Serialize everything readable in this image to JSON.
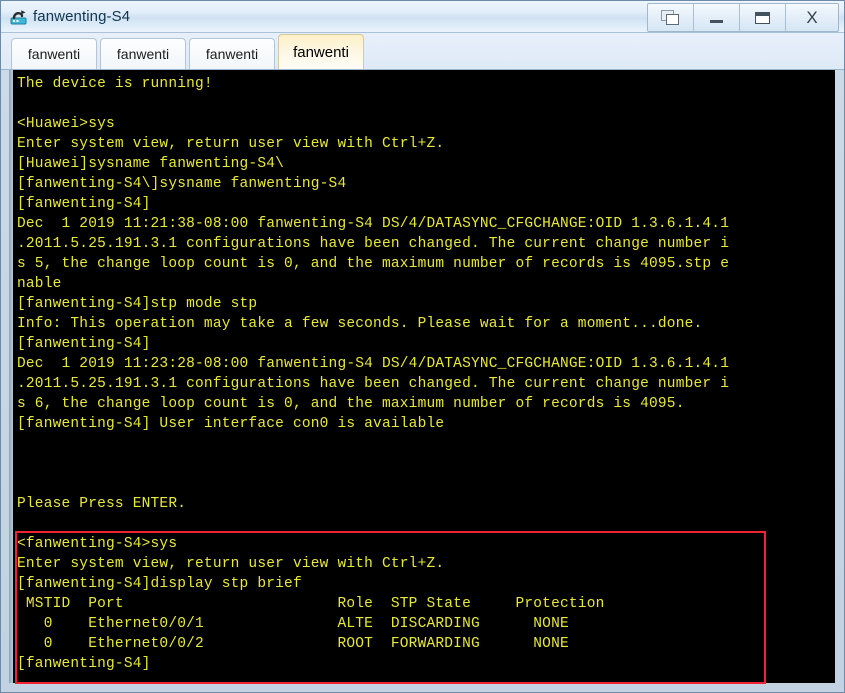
{
  "window": {
    "title": "fanwenting-S4",
    "icon": "router-device-icon",
    "controls": [
      {
        "name": "restore-windows-button",
        "icon": "cascade-windows-icon",
        "label": ""
      },
      {
        "name": "minimize-button",
        "icon": "minimize-icon",
        "label": ""
      },
      {
        "name": "maximize-button",
        "icon": "maximize-icon",
        "label": ""
      },
      {
        "name": "close-button",
        "icon": "close-icon",
        "label": "X"
      }
    ]
  },
  "tabs": [
    {
      "label": "fanwenti",
      "active": false
    },
    {
      "label": "fanwenti",
      "active": false
    },
    {
      "label": "fanwenti",
      "active": false
    },
    {
      "label": "fanwenti",
      "active": true
    }
  ],
  "terminal": {
    "foreground_color": "#e8e83a",
    "background_color": "#000000",
    "lines": [
      "The device is running!",
      "",
      "<Huawei>sys",
      "Enter system view, return user view with Ctrl+Z.",
      "[Huawei]sysname fanwenting-S4\\",
      "[fanwenting-S4\\]sysname fanwenting-S4",
      "[fanwenting-S4]",
      "Dec  1 2019 11:21:38-08:00 fanwenting-S4 DS/4/DATASYNC_CFGCHANGE:OID 1.3.6.1.4.1",
      ".2011.5.25.191.3.1 configurations have been changed. The current change number i",
      "s 5, the change loop count is 0, and the maximum number of records is 4095.stp e",
      "nable",
      "[fanwenting-S4]stp mode stp",
      "Info: This operation may take a few seconds. Please wait for a moment...done.",
      "[fanwenting-S4]",
      "Dec  1 2019 11:23:28-08:00 fanwenting-S4 DS/4/DATASYNC_CFGCHANGE:OID 1.3.6.1.4.1",
      ".2011.5.25.191.3.1 configurations have been changed. The current change number i",
      "s 6, the change loop count is 0, and the maximum number of records is 4095.",
      "[fanwenting-S4] User interface con0 is available",
      "",
      "",
      "",
      "Please Press ENTER.",
      "",
      "<fanwenting-S4>sys",
      "Enter system view, return user view with Ctrl+Z.",
      "[fanwenting-S4]display stp brief",
      " MSTID  Port                        Role  STP State     Protection",
      "   0    Ethernet0/0/1               ALTE  DISCARDING      NONE",
      "   0    Ethernet0/0/2               ROOT  FORWARDING      NONE",
      "[fanwenting-S4]"
    ]
  },
  "stp_brief": {
    "command": "display stp brief",
    "columns": [
      "MSTID",
      "Port",
      "Role",
      "STP State",
      "Protection"
    ],
    "rows": [
      [
        "0",
        "Ethernet0/0/1",
        "ALTE",
        "DISCARDING",
        "NONE"
      ],
      [
        "0",
        "Ethernet0/0/2",
        "ROOT",
        "FORWARDING",
        "NONE"
      ]
    ]
  },
  "annotation": {
    "highlight_color": "#f02233",
    "shape": "rectangle"
  }
}
